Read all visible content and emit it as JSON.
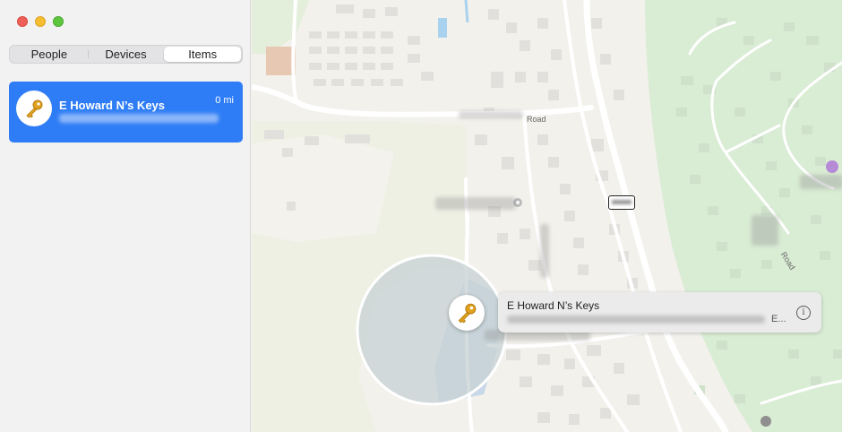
{
  "sidebar": {
    "tabs": [
      {
        "label": "People",
        "active": false
      },
      {
        "label": "Devices",
        "active": false
      },
      {
        "label": "Items",
        "active": true
      }
    ],
    "items": [
      {
        "title": "E Howard N’s Keys",
        "distance": "0 mi",
        "icon": "key-icon",
        "selected": true
      }
    ]
  },
  "map": {
    "road_labels": [
      "Road",
      "Road"
    ],
    "callout": {
      "title": "E Howard N’s Keys",
      "ellipsis": "E..."
    },
    "info_symbol": "i"
  },
  "colors": {
    "accent": "#2f7df6",
    "park": "#d8ebd3",
    "accuracy_circle": "#c9d3d6",
    "building": "#e2e0dc",
    "road": "#ffffff"
  }
}
